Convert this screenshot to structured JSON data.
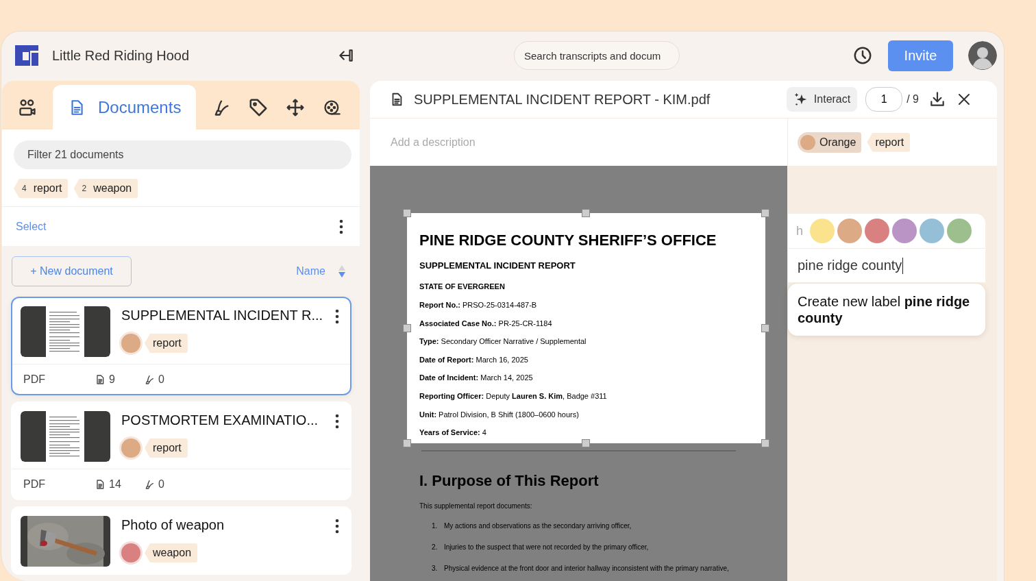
{
  "app": {
    "title": "Little Red Riding Hood"
  },
  "search": {
    "placeholder": "Search transcripts and docum"
  },
  "invite_button": "Invite",
  "sidebar": {
    "tabs": [
      {
        "kind": "people",
        "selected": false
      },
      {
        "kind": "documents",
        "label": "Documents",
        "selected": true
      },
      {
        "kind": "highlighter",
        "selected": false
      },
      {
        "kind": "tag",
        "selected": false
      },
      {
        "kind": "move",
        "selected": false
      },
      {
        "kind": "reel",
        "selected": false
      }
    ],
    "filter": {
      "placeholder": "Filter 21 documents"
    },
    "tag_filters": [
      {
        "count": "4",
        "label": "report"
      },
      {
        "count": "2",
        "label": "weapon"
      }
    ],
    "select_link": "Select",
    "new_document_button": "+ New document",
    "sort": {
      "label": "Name"
    },
    "documents": [
      {
        "title": "SUPPLEMENTAL INCIDENT R...",
        "selected": true,
        "label": {
          "text": "report",
          "color": "#dcaa85"
        },
        "type": "PDF",
        "pages": "9",
        "highlights": "0"
      },
      {
        "title": "POSTMORTEM EXAMINATIO...",
        "selected": false,
        "label": {
          "text": "report",
          "color": "#dcaa85"
        },
        "type": "PDF",
        "pages": "14",
        "highlights": "0"
      },
      {
        "title": "Photo of weapon",
        "selected": false,
        "kind": "picture",
        "label": {
          "text": "weapon",
          "color": "#d98080"
        }
      }
    ]
  },
  "viewer": {
    "title": "SUPPLEMENTAL INCIDENT REPORT - KIM.pdf",
    "interact_button": "Interact",
    "page": "1",
    "page_total": "/ 9",
    "description": {
      "placeholder": "Add a description"
    },
    "labels": [
      {
        "kind": "color",
        "text": "Orange",
        "color": "#dcaa85"
      },
      {
        "kind": "tag",
        "text": "report"
      }
    ],
    "document": {
      "heading": "PINE RIDGE COUNTY SHERIFF’S OFFICE",
      "subheading": "SUPPLEMENTAL INCIDENT REPORT",
      "state": "STATE OF EVERGREEN",
      "fields": [
        "**Report No.:** PRSO-25-0314-487-B",
        "**Associated Case No.:** PR-25-CR-1184",
        "**Type:** Secondary Officer Narrative / Supplemental",
        "**Date of Report:** March 16, 2025",
        "**Date of Incident:** March 14, 2025",
        "**Reporting Officer:** Deputy **Lauren S. Kim**, Badge #311",
        "**Unit:** Patrol Division, B Shift (1800–0600 hours)",
        "**Years of Service:** 4"
      ],
      "section_title": "I. Purpose of This Report",
      "intro": "This supplemental report documents:",
      "list": [
        {
          "number": "1.",
          "text": "My actions and observations as the secondary arriving officer,"
        },
        {
          "number": "2.",
          "text": "Injuries to the suspect that were not recorded by the primary officer,"
        },
        {
          "number": "3.",
          "text": "Physical evidence at the front door and interior hallway inconsistent with the primary narrative,"
        }
      ]
    }
  },
  "label_editor": {
    "prefix": "h",
    "colors": [
      {
        "color": "#fbe38e",
        "selected": false
      },
      {
        "color": "#dcaa85",
        "selected": false
      },
      {
        "color": "#d98080",
        "selected": false
      },
      {
        "color": "#b994c4",
        "selected": false
      },
      {
        "color": "#95bfd6",
        "selected": false
      },
      {
        "color": "#9dbf8e",
        "selected": false
      }
    ],
    "value": "pine ridge county",
    "suggestion": "Create new label **pine ridge county**"
  }
}
